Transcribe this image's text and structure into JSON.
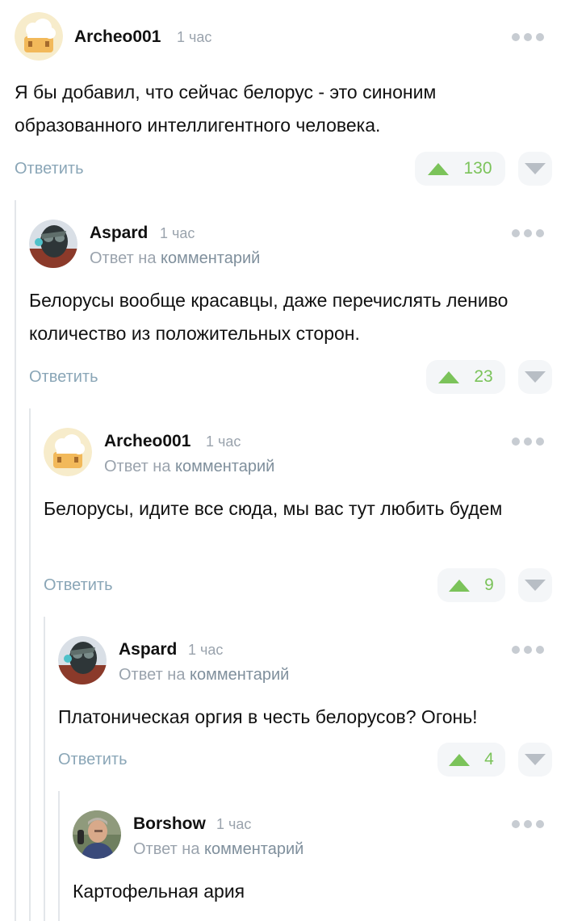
{
  "comments": [
    {
      "author": "Archeo001",
      "time": "1 час",
      "reply_prefix": "",
      "reply_link": "",
      "text": "Я бы добавил, что сейчас белорус - это синоним образованного интеллигентного человека.",
      "reply_label": "Ответить",
      "score": "130"
    },
    {
      "author": "Aspard",
      "time": "1 час",
      "reply_prefix": "Ответ на",
      "reply_link": "комментарий",
      "text": "Белорусы вообще красавцы, даже перечислять лениво количество из положительных сторон.",
      "reply_label": "Ответить",
      "score": "23"
    },
    {
      "author": "Archeo001",
      "time": "1 час",
      "reply_prefix": "Ответ на",
      "reply_link": "комментарий",
      "text": "Белорусы, идите все сюда, мы вас тут любить будем",
      "reply_label": "Ответить",
      "score": "9"
    },
    {
      "author": "Aspard",
      "time": "1 час",
      "reply_prefix": "Ответ на",
      "reply_link": "комментарий",
      "text": "Платоническая оргия в честь белорусов? Огонь!",
      "reply_label": "Ответить",
      "score": "4"
    },
    {
      "author": "Borshow",
      "time": "1 час",
      "reply_prefix": "Ответ на",
      "reply_link": "комментарий",
      "text": "Картофельная ария",
      "reply_label": "",
      "score": ""
    }
  ],
  "icons": {
    "more": "more-dots-icon",
    "upvote": "upvote-triangle-icon",
    "downvote": "downvote-triangle-icon"
  },
  "colors": {
    "upvote": "#7bc35a",
    "reply_link": "#8aa6b7",
    "muted": "#9aa3ad",
    "thread_line": "#e3e6ea"
  }
}
